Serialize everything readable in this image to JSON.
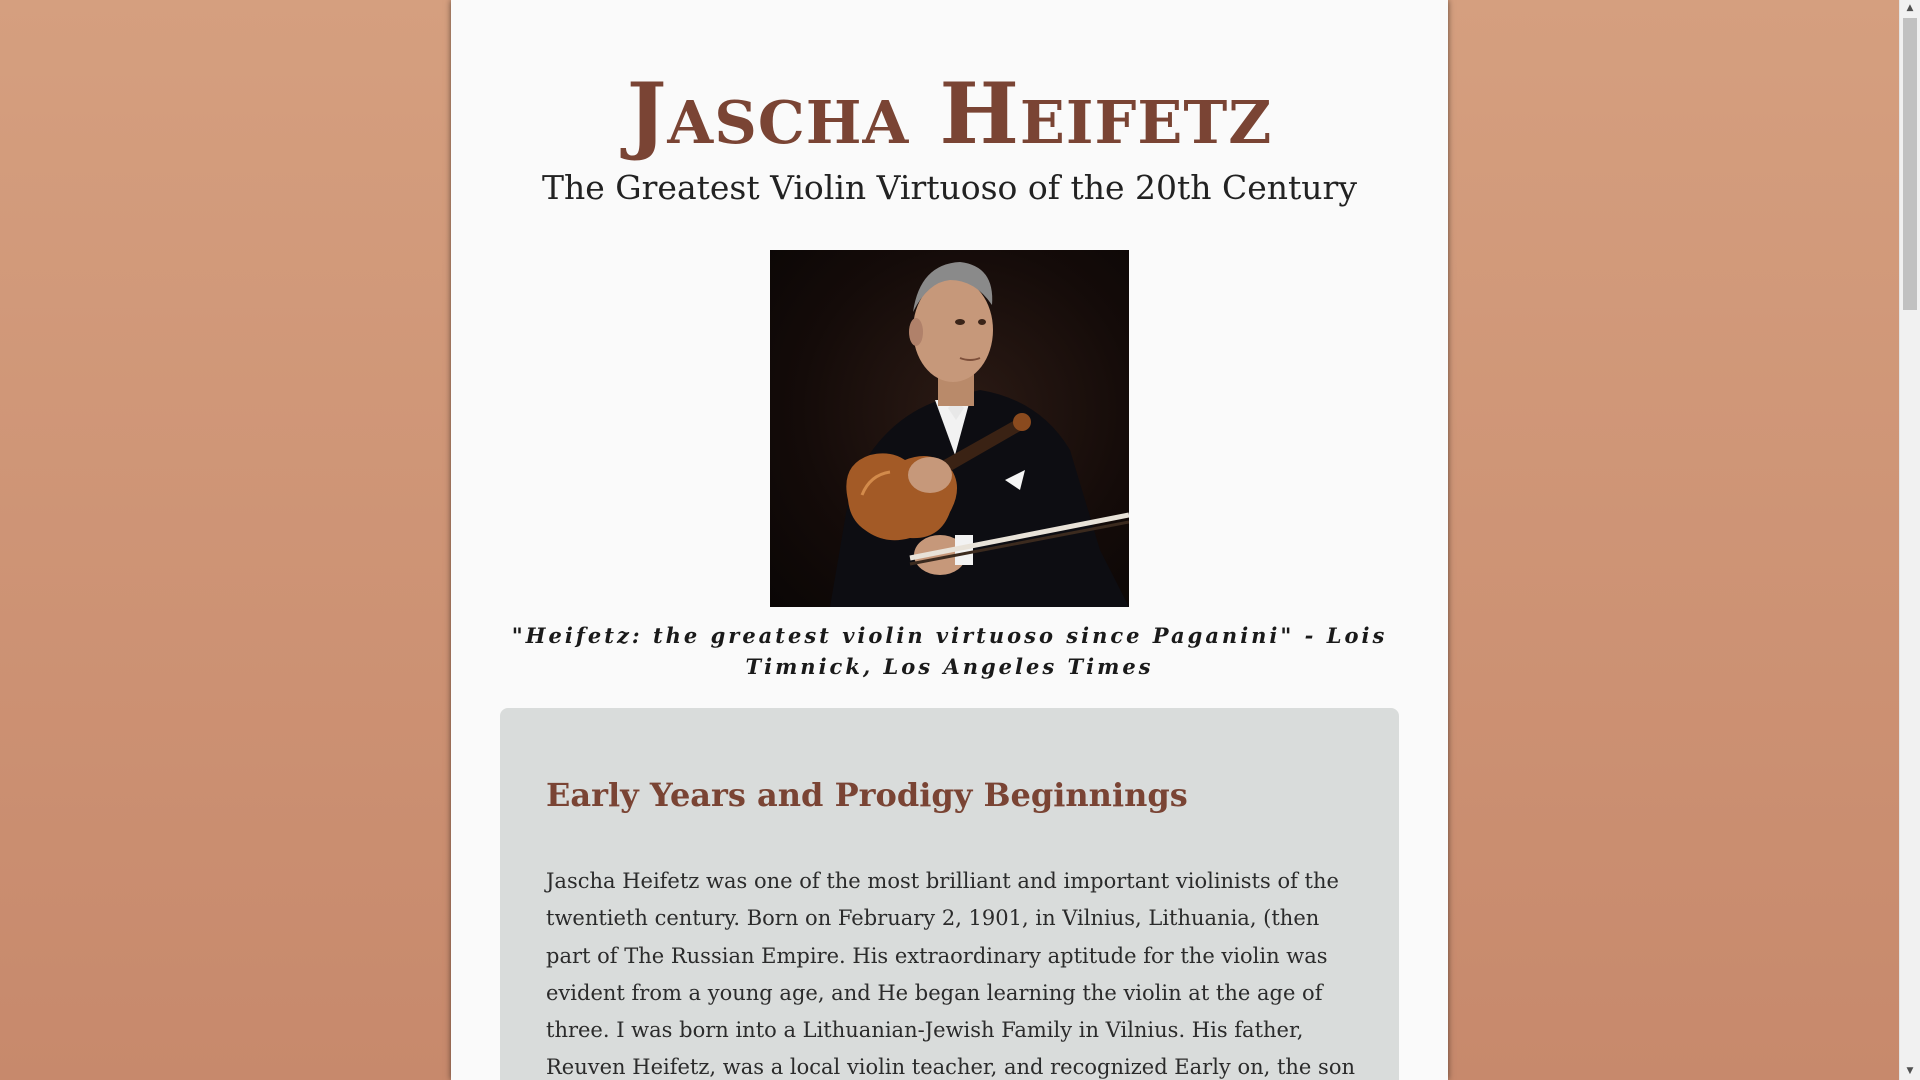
{
  "header": {
    "title": "Jascha Heifetz",
    "subtitle": "The Greatest Violin Virtuoso of the 20th Century"
  },
  "portrait": {
    "icon": "portrait-photo"
  },
  "quote": {
    "text": "\"Heifetz: the greatest violin virtuoso since Paganini\" - Lois Timnick, Los Angeles Times"
  },
  "section": {
    "heading": "Early Years and Prodigy Beginnings",
    "body": "Jascha Heifetz was one of the most brilliant and important violinists of the twentieth century. Born on February 2, 1901, in Vilnius, Lithuania, (then part of The Russian Empire. His extraordinary aptitude for the violin was evident from a young age, and He began learning the violin at the age of three. I was born into a Lithuanian-Jewish Family in Vilnius. His father, Reuven Heifetz, was a local violin teacher, and recognized Early on, the son shown enormous"
  },
  "scrollbar": {
    "up_icon": "▲",
    "down_icon": "▼"
  },
  "colors": {
    "accent": "#7a4434",
    "background": "#d59f7f",
    "card": "#d9dcdb",
    "page": "#fafafa"
  }
}
